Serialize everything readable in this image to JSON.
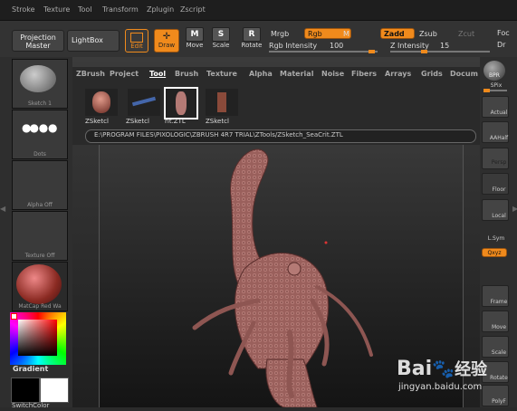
{
  "menu": [
    "Stroke",
    "Texture",
    "Tool",
    "Transform",
    "Zplugin",
    "Zscript"
  ],
  "toolbar": {
    "projection_master": "Projection Master",
    "lightbox": "LightBox",
    "edit": "Edit",
    "draw": "Draw",
    "move": "Move",
    "scale": "Scale",
    "rotate": "Rotate",
    "move_key": "M",
    "scale_key": "S",
    "rotate_key": "R",
    "mrgb": "Mrgb",
    "rgb": "Rgb",
    "m": "M",
    "zadd": "Zadd",
    "zsub": "Zsub",
    "zcut": "Zcut",
    "foc": "Foc",
    "dr": "Dr",
    "rgb_intensity_label": "Rgb Intensity",
    "rgb_intensity_value": "100",
    "z_intensity_label": "Z Intensity",
    "z_intensity_value": "15"
  },
  "left": {
    "sketch": "Sketch 1",
    "dots": "Dots",
    "alpha": "Alpha Off",
    "texture": "Texture Off",
    "matcap": "MatCap Red Wa",
    "gradient": "Gradient",
    "switch_color": "SwitchColor"
  },
  "tool_tabs": [
    "ZBrush",
    "Project",
    "Tool",
    "Brush",
    "Texture",
    "Alpha",
    "Material",
    "Noise",
    "Fibers",
    "Arrays",
    "Grids",
    "Docum"
  ],
  "thumbs": [
    "ZSketcl",
    "ZSketcl",
    "rit.ZTL",
    "ZSketcl"
  ],
  "path": "E:\\PROGRAM FILES\\PIXOLOGIC\\ZBRUSH 4R7 TRIAL\\ZTools/ZSketch_SeaCrit.ZTL",
  "right": {
    "bpr": "BPR",
    "spix": "SPix",
    "actual": "Actual",
    "aahalf": "AAHalf",
    "persp": "Persp",
    "floor": "Floor",
    "local": "Local",
    "lsym": "L.Sym",
    "xyz": "Qxyz",
    "frame": "Frame",
    "move": "Move",
    "scale": "Scale",
    "rotate": "Rotate",
    "polyf": "PolyF"
  },
  "watermark": {
    "brand": "Bai",
    "brand2": "经验",
    "site": "jingyan.baidu.com"
  },
  "colors": {
    "accent": "#f08a1c",
    "model": "#a86a66"
  }
}
